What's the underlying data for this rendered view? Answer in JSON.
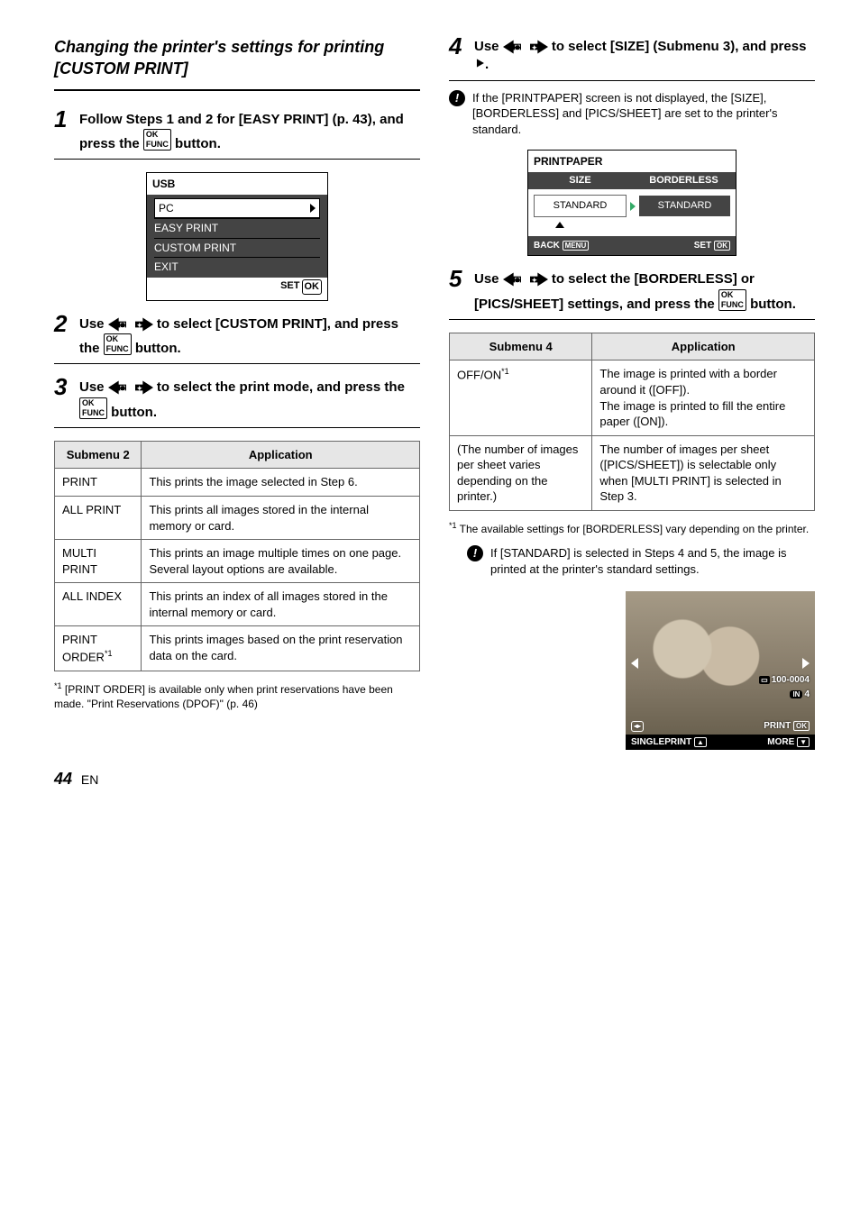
{
  "title": "Changing the printer's settings for printing [CUSTOM PRINT]",
  "steps": {
    "s1": "Follow Steps 1 and 2 for [EASY PRINT] (p. 43), and press the ",
    "s1b": " button.",
    "s2a": "Use ",
    "s2b": " to select [CUSTOM PRINT], and press the ",
    "s2c": " button.",
    "s3a": "Use ",
    "s3b": " to select the print mode, and press the ",
    "s3c": " button.",
    "s4a": "Use ",
    "s4b": " to select [SIZE] (Submenu 3), and press ",
    "s4c": ".",
    "s5a": "Use ",
    "s5b": " to select the [BORDERLESS] or [PICS/SHEET] settings, and press the ",
    "s5c": " button."
  },
  "usb_screen": {
    "title": "USB",
    "items": [
      "PC",
      "EASY PRINT",
      "CUSTOM PRINT",
      "EXIT"
    ],
    "set": "SET",
    "ok": "OK"
  },
  "table1": {
    "h1": "Submenu 2",
    "h2": "Application",
    "rows": [
      {
        "k": "PRINT",
        "v": "This prints the image selected in Step 6."
      },
      {
        "k": "ALL PRINT",
        "v": "This prints all images stored in the internal memory or card."
      },
      {
        "k": "MULTI PRINT",
        "v": "This prints an image multiple times on one page. Several layout options are available."
      },
      {
        "k": "ALL INDEX",
        "v": "This prints an index of all images stored in the internal memory or card."
      },
      {
        "k": "PRINT ORDER",
        "v": "This prints images based on the print reservation data on the card."
      }
    ],
    "footnote": "[PRINT ORDER] is available only when print reservations have been made. \"Print Reservations (DPOF)\" (p. 46)"
  },
  "note4": "If the [PRINTPAPER] screen is not displayed, the [SIZE], [BORDERLESS] and [PICS/SHEET] are set to the printer's standard.",
  "pp_screen": {
    "title": "PRINTPAPER",
    "h1": "SIZE",
    "h2": "BORDERLESS",
    "v1": "STANDARD",
    "v2": "STANDARD",
    "back": "BACK",
    "menu": "MENU",
    "set": "SET",
    "ok": "OK"
  },
  "table2": {
    "h1": "Submenu 4",
    "h2": "Application",
    "rows": [
      {
        "k": "OFF/ON",
        "v": "The image is printed with a border around it ([OFF]).\nThe image is printed to fill the entire paper ([ON])."
      },
      {
        "k": "(The number of images per sheet varies depending on the printer.)",
        "v": "The number of images per sheet ([PICS/SHEET]) is selectable only when [MULTI PRINT] is selected in Step 3."
      }
    ],
    "footnote": "The available settings for [BORDERLESS] vary depending on the printer."
  },
  "note5": "If [STANDARD] is selected in Steps 4 and 5, the image is printed at the printer's standard settings.",
  "sample": {
    "file": "100-0004",
    "in": "IN",
    "four": "4",
    "print": "PRINT",
    "ok": "OK",
    "single": "SINGLEPRINT",
    "more": "MORE"
  },
  "footer": {
    "page": "44",
    "lang": "EN"
  }
}
